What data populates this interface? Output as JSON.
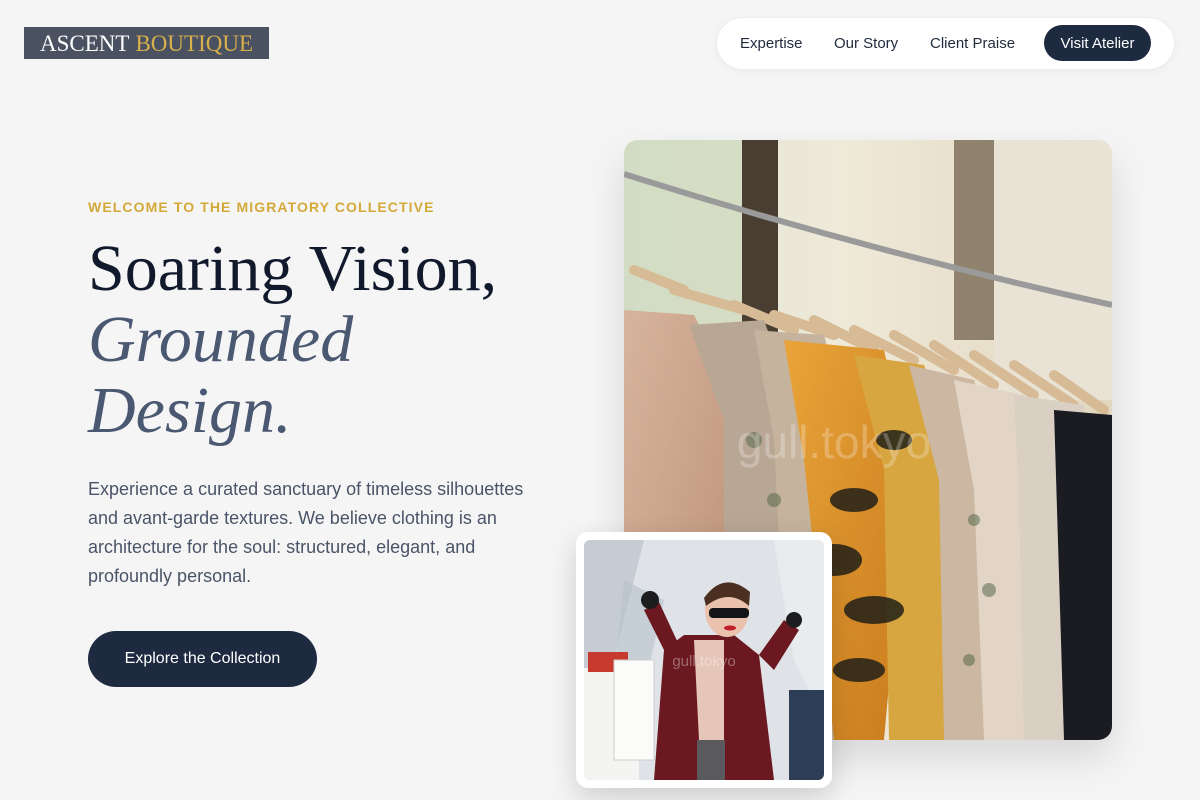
{
  "brand": {
    "word1": "ASCENT",
    "word2": "BOUTIQUE",
    "colors": {
      "primary": "#1e2a40",
      "accent": "#d4a93a",
      "logo_bg": "#4a5262"
    }
  },
  "nav": {
    "links": [
      "Expertise",
      "Our Story",
      "Client Praise"
    ],
    "cta": "Visit Atelier"
  },
  "hero": {
    "eyebrow": "WELCOME TO THE MIGRATORY COLLECTIVE",
    "headline_line1": "Soaring Vision,",
    "headline_line2": "Grounded",
    "headline_line3": "Design.",
    "body": "Experience a curated sanctuary of timeless silhouettes and avant-garde textures. We believe clothing is an architecture for the soul: structured, elegant, and profoundly personal.",
    "cta": "Explore the Collection"
  },
  "images": {
    "main_icon": "clothing-rack-photo",
    "secondary_icon": "shopper-photo",
    "watermark_main": "gull.tokyo",
    "watermark_secondary": "gull.tokyo"
  }
}
